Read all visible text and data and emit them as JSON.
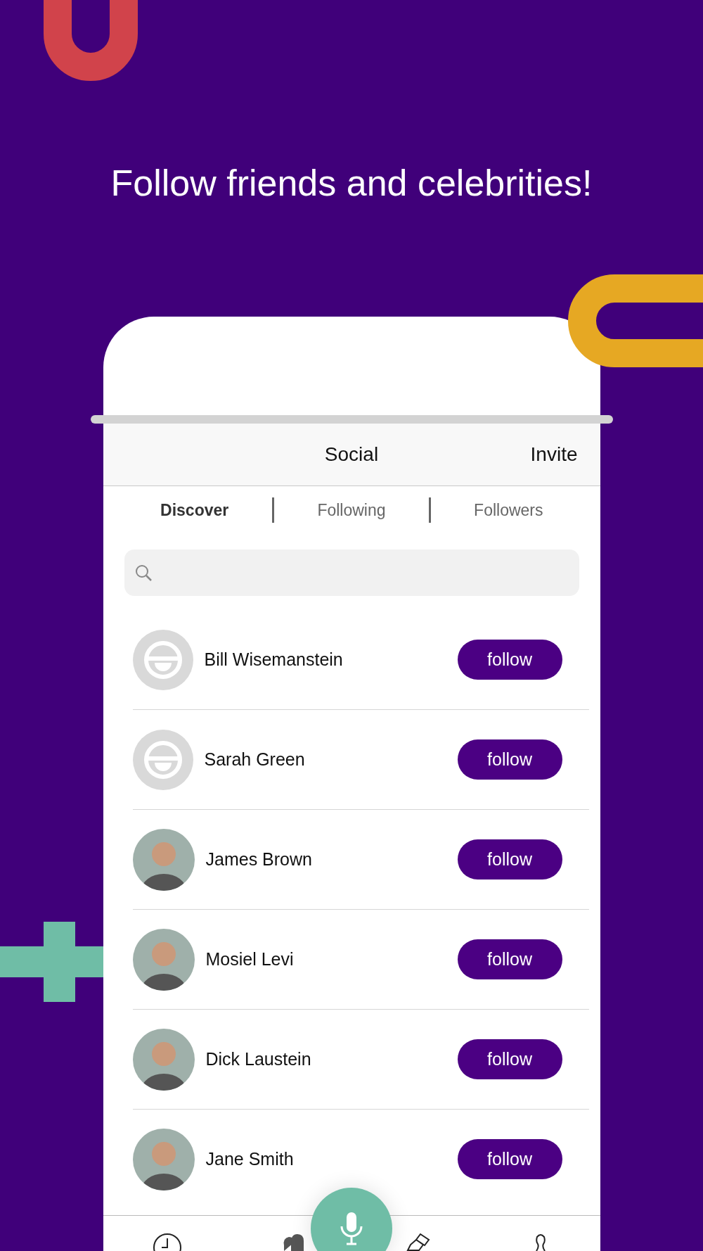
{
  "headline": "Follow friends and celebrities!",
  "header": {
    "title": "Social",
    "action": "Invite"
  },
  "tabs": [
    {
      "label": "Discover",
      "selected": true
    },
    {
      "label": "Following",
      "selected": false
    },
    {
      "label": "Followers",
      "selected": false
    }
  ],
  "people": [
    {
      "name": "Bill Wisemanstein",
      "kind": "default",
      "button": "follow"
    },
    {
      "name": "Sarah Green",
      "kind": "default",
      "button": "follow"
    },
    {
      "name": "James Brown",
      "kind": "photo",
      "button": "follow"
    },
    {
      "name": "Mosiel Levi",
      "kind": "photo",
      "button": "follow"
    },
    {
      "name": "Dick Laustein",
      "kind": "photo",
      "button": "follow"
    },
    {
      "name": "Jane Smith",
      "kind": "photo",
      "button": "follow"
    }
  ],
  "nav": [
    {
      "kind": "clock"
    },
    {
      "kind": "people"
    },
    {
      "kind": "mic"
    },
    {
      "kind": "brush"
    },
    {
      "kind": "person"
    }
  ]
}
